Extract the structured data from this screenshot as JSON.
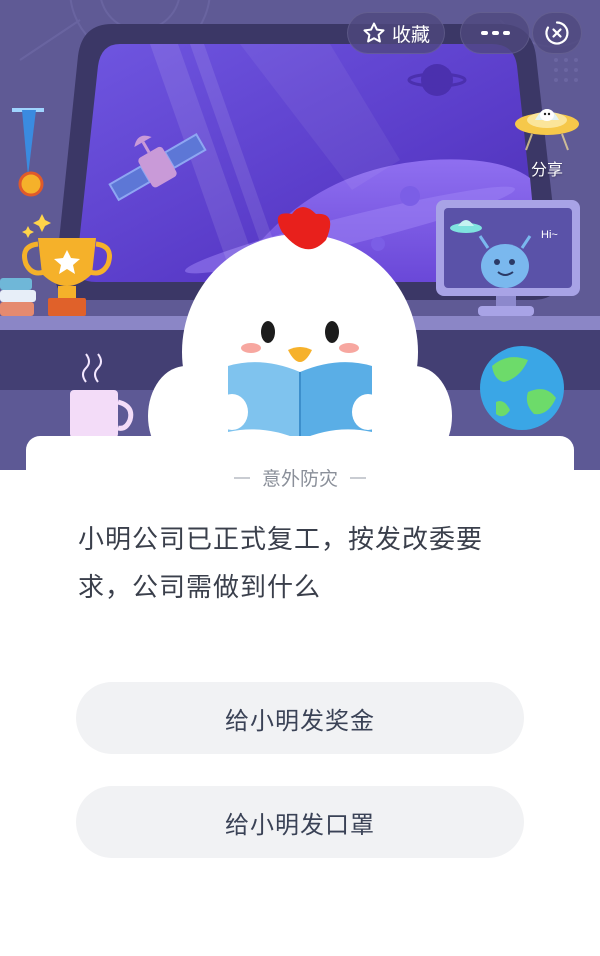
{
  "toolbar": {
    "favorite_label": "收藏",
    "favorite_icon": "star-outline-icon",
    "more_icon": "more-dots-icon",
    "close_icon": "target-close-icon"
  },
  "share": {
    "label": "分享",
    "icon": "ufo-penguin-icon"
  },
  "scene": {
    "monitor_text": "Hi~"
  },
  "quiz": {
    "category": "意外防灾",
    "question": "小明公司已正式复工，按发改委要求，公司需做到什么",
    "options": [
      {
        "label": "给小明发奖金"
      },
      {
        "label": "给小明发口罩"
      }
    ]
  },
  "colors": {
    "scene_background": "#5f5a95",
    "window_space": "#5b3fd0",
    "card_background": "#ffffff",
    "option_background": "#f1f2f4",
    "question_text": "#3a3f4b",
    "category_text": "#8a8f99"
  }
}
